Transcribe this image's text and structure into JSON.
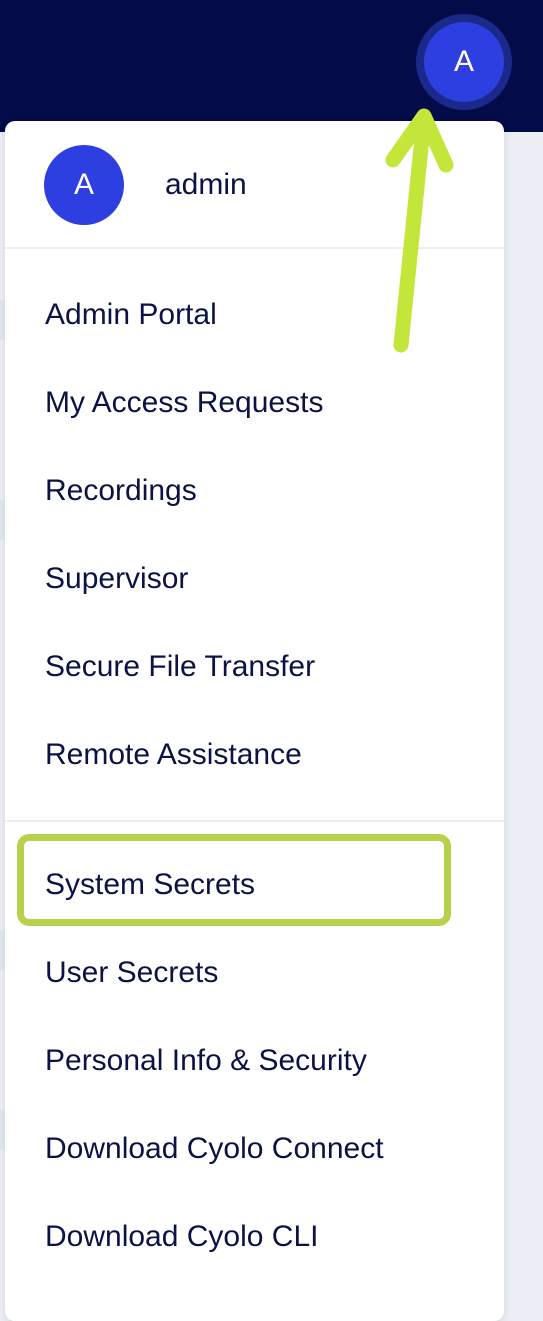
{
  "header": {
    "avatar_initial": "A"
  },
  "user": {
    "avatar_initial": "A",
    "name": "admin"
  },
  "menu": {
    "group1": [
      {
        "label": "Admin Portal"
      },
      {
        "label": "My Access Requests"
      },
      {
        "label": "Recordings"
      },
      {
        "label": "Supervisor"
      },
      {
        "label": "Secure File Transfer"
      },
      {
        "label": "Remote Assistance"
      }
    ],
    "group2": [
      {
        "label": "System Secrets"
      },
      {
        "label": "User Secrets"
      },
      {
        "label": "Personal Info & Security"
      },
      {
        "label": "Download Cyolo Connect"
      },
      {
        "label": "Download Cyolo CLI"
      }
    ]
  },
  "annotations": {
    "highlighted_item": "System Secrets",
    "highlight_color": "#b6d24c",
    "arrow_color": "#c4e63a"
  },
  "colors": {
    "header_bg": "#030b48",
    "avatar_bg": "#2d3fe0",
    "text": "#0b1244"
  }
}
